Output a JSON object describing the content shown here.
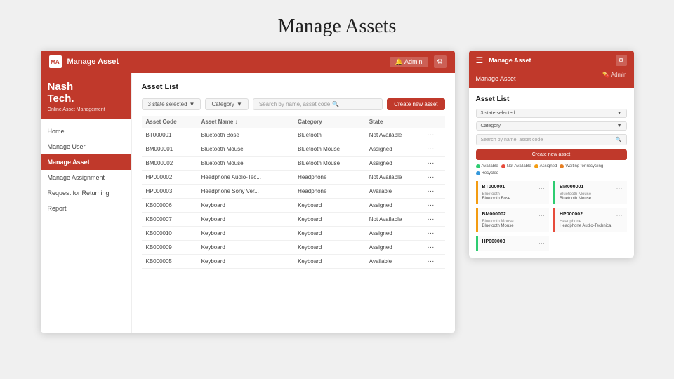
{
  "page": {
    "title": "Manage Assets"
  },
  "desktop": {
    "topbar": {
      "logo_text": "MA",
      "title": "Manage Asset",
      "user_label": "🔔 Admin",
      "gear_icon": "⚙"
    },
    "sidebar": {
      "brand_name": "Nash\nTech.",
      "brand_sub": "Online Asset Management",
      "nav_items": [
        {
          "label": "Home",
          "active": false
        },
        {
          "label": "Manage User",
          "active": false
        },
        {
          "label": "Manage Asset",
          "active": true
        },
        {
          "label": "Manage Assignment",
          "active": false
        },
        {
          "label": "Request for Returning",
          "active": false
        },
        {
          "label": "Report",
          "active": false
        }
      ]
    },
    "main": {
      "section_title": "Asset List",
      "filter_state": "3 state selected",
      "filter_category": "Category",
      "search_placeholder": "Search by name, asset code",
      "create_btn": "Create new asset",
      "table": {
        "headers": [
          "Asset Code",
          "Asset Name ↕",
          "Category",
          "State",
          ""
        ],
        "rows": [
          {
            "code": "BT000001",
            "name": "Bluetooth Bose",
            "category": "Bluetooth",
            "state": "Not Available"
          },
          {
            "code": "BM000001",
            "name": "Bluetooth Mouse",
            "category": "Bluetooth Mouse",
            "state": "Assigned"
          },
          {
            "code": "BM000002",
            "name": "Bluetooth Mouse",
            "category": "Bluetooth Mouse",
            "state": "Assigned"
          },
          {
            "code": "HP000002",
            "name": "Headphone Audio-Tec...",
            "category": "Headphone",
            "state": "Not Available"
          },
          {
            "code": "HP000003",
            "name": "Headphone Sony Ver...",
            "category": "Headphone",
            "state": "Available"
          },
          {
            "code": "KB000006",
            "name": "Keyboard",
            "category": "Keyboard",
            "state": "Assigned"
          },
          {
            "code": "KB000007",
            "name": "Keyboard",
            "category": "Keyboard",
            "state": "Not Available"
          },
          {
            "code": "KB000010",
            "name": "Keyboard",
            "category": "Keyboard",
            "state": "Assigned"
          },
          {
            "code": "KB000009",
            "name": "Keyboard",
            "category": "Keyboard",
            "state": "Assigned"
          },
          {
            "code": "KB000005",
            "name": "Keyboard",
            "category": "Keyboard",
            "state": "Available"
          }
        ]
      }
    }
  },
  "mobile": {
    "topbar": {
      "hamburger": "☰",
      "title": "Manage Asset",
      "subtitle": "Manage Asset",
      "user": "💊 Admin",
      "gear_icon": "⚙"
    },
    "main": {
      "section_title": "Asset List",
      "filter_state": "3 state selected",
      "filter_category": "Category",
      "search_placeholder": "Search by name, asset code",
      "create_btn": "Create new asset",
      "legend": [
        {
          "label": "Available",
          "color": "green"
        },
        {
          "label": "Not Available",
          "color": "red"
        },
        {
          "label": "Assigned",
          "color": "yellow"
        },
        {
          "label": "Waiting for recycling",
          "color": "orange"
        },
        {
          "label": "Recycled",
          "color": "blue"
        }
      ],
      "cards": [
        {
          "code": "BT000001",
          "category": "Bluetooth",
          "name": "Bluetooth Bose",
          "color": "yellow"
        },
        {
          "code": "BM000001",
          "category": "Bluetooth Mouse",
          "name": "Bluetooth Mouse",
          "color": "green"
        },
        {
          "code": "BM000002",
          "category": "Bluetooth Mouse",
          "name": "Bluetooth Mouse",
          "color": "yellow"
        },
        {
          "code": "HP000002",
          "category": "Headphone",
          "name": "Headphone Audio-Technica",
          "color": "red"
        },
        {
          "code": "HP000003",
          "category": "",
          "name": "",
          "color": "green"
        }
      ]
    }
  }
}
